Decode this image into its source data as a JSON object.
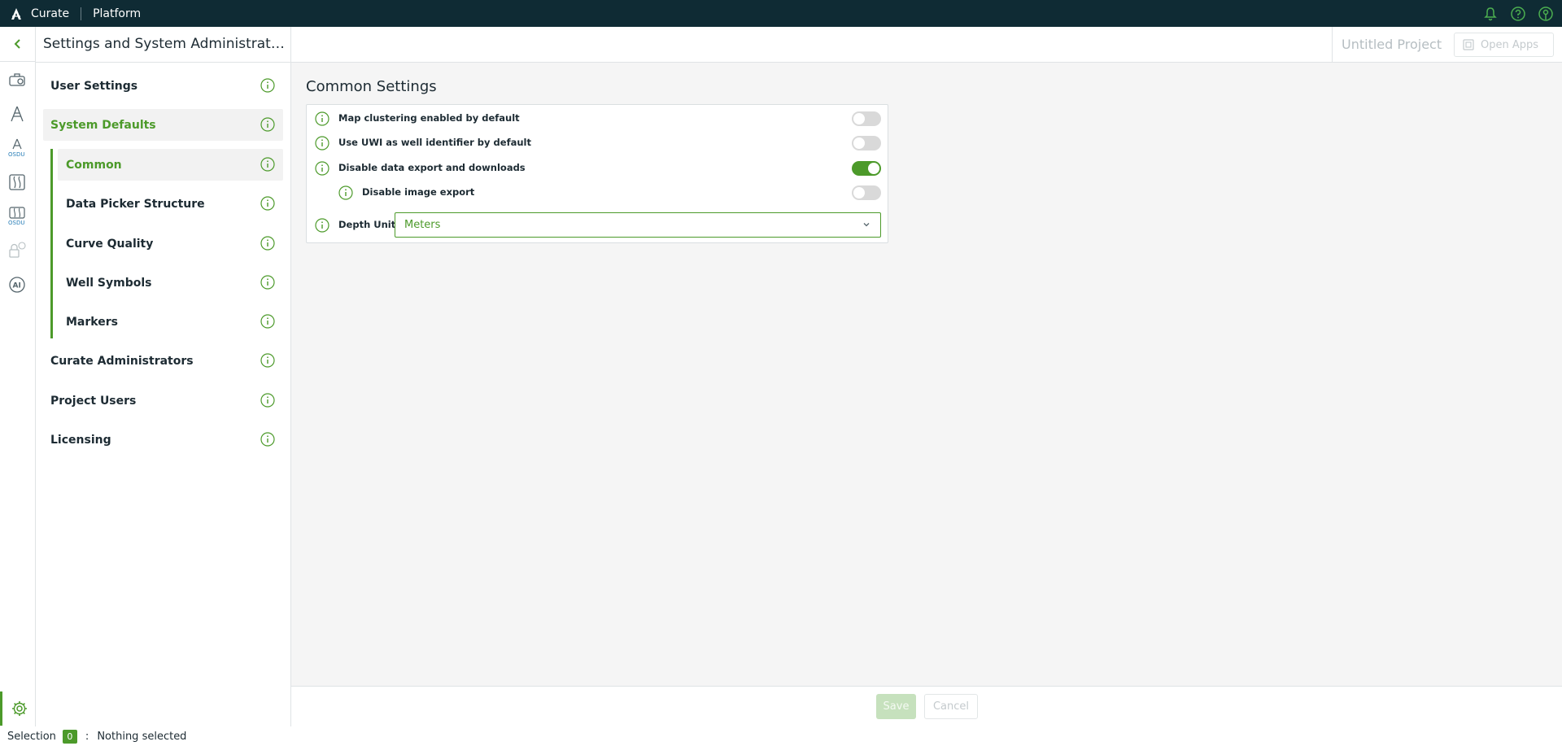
{
  "topbar": {
    "app": "Curate",
    "platform": "Platform"
  },
  "header": {
    "title": "Settings and System Administration",
    "project": "Untitled Project",
    "open_apps": "Open Apps"
  },
  "nav": {
    "user_settings": "User Settings",
    "system_defaults": "System Defaults",
    "common": "Common",
    "data_picker": "Data Picker Structure",
    "curve_quality": "Curve Quality",
    "well_symbols": "Well Symbols",
    "markers": "Markers",
    "curate_admins": "Curate Administrators",
    "project_users": "Project Users",
    "licensing": "Licensing"
  },
  "main": {
    "heading": "Common Settings",
    "map_clustering": "Map clustering enabled by default",
    "use_uwi": "Use UWI as well identifier by default",
    "disable_export": "Disable data export and downloads",
    "disable_image": "Disable image export",
    "depth_unit_label": "Depth Unit",
    "depth_unit_value": "Meters",
    "toggles": {
      "map_clustering": false,
      "use_uwi": false,
      "disable_export": true,
      "disable_image": false
    }
  },
  "footer": {
    "save": "Save",
    "cancel": "Cancel"
  },
  "status": {
    "label": "Selection",
    "count": "0",
    "colon": ":",
    "text": "Nothing selected"
  },
  "colors": {
    "accent": "#4c9a2a",
    "topbar": "#0f2b34"
  }
}
